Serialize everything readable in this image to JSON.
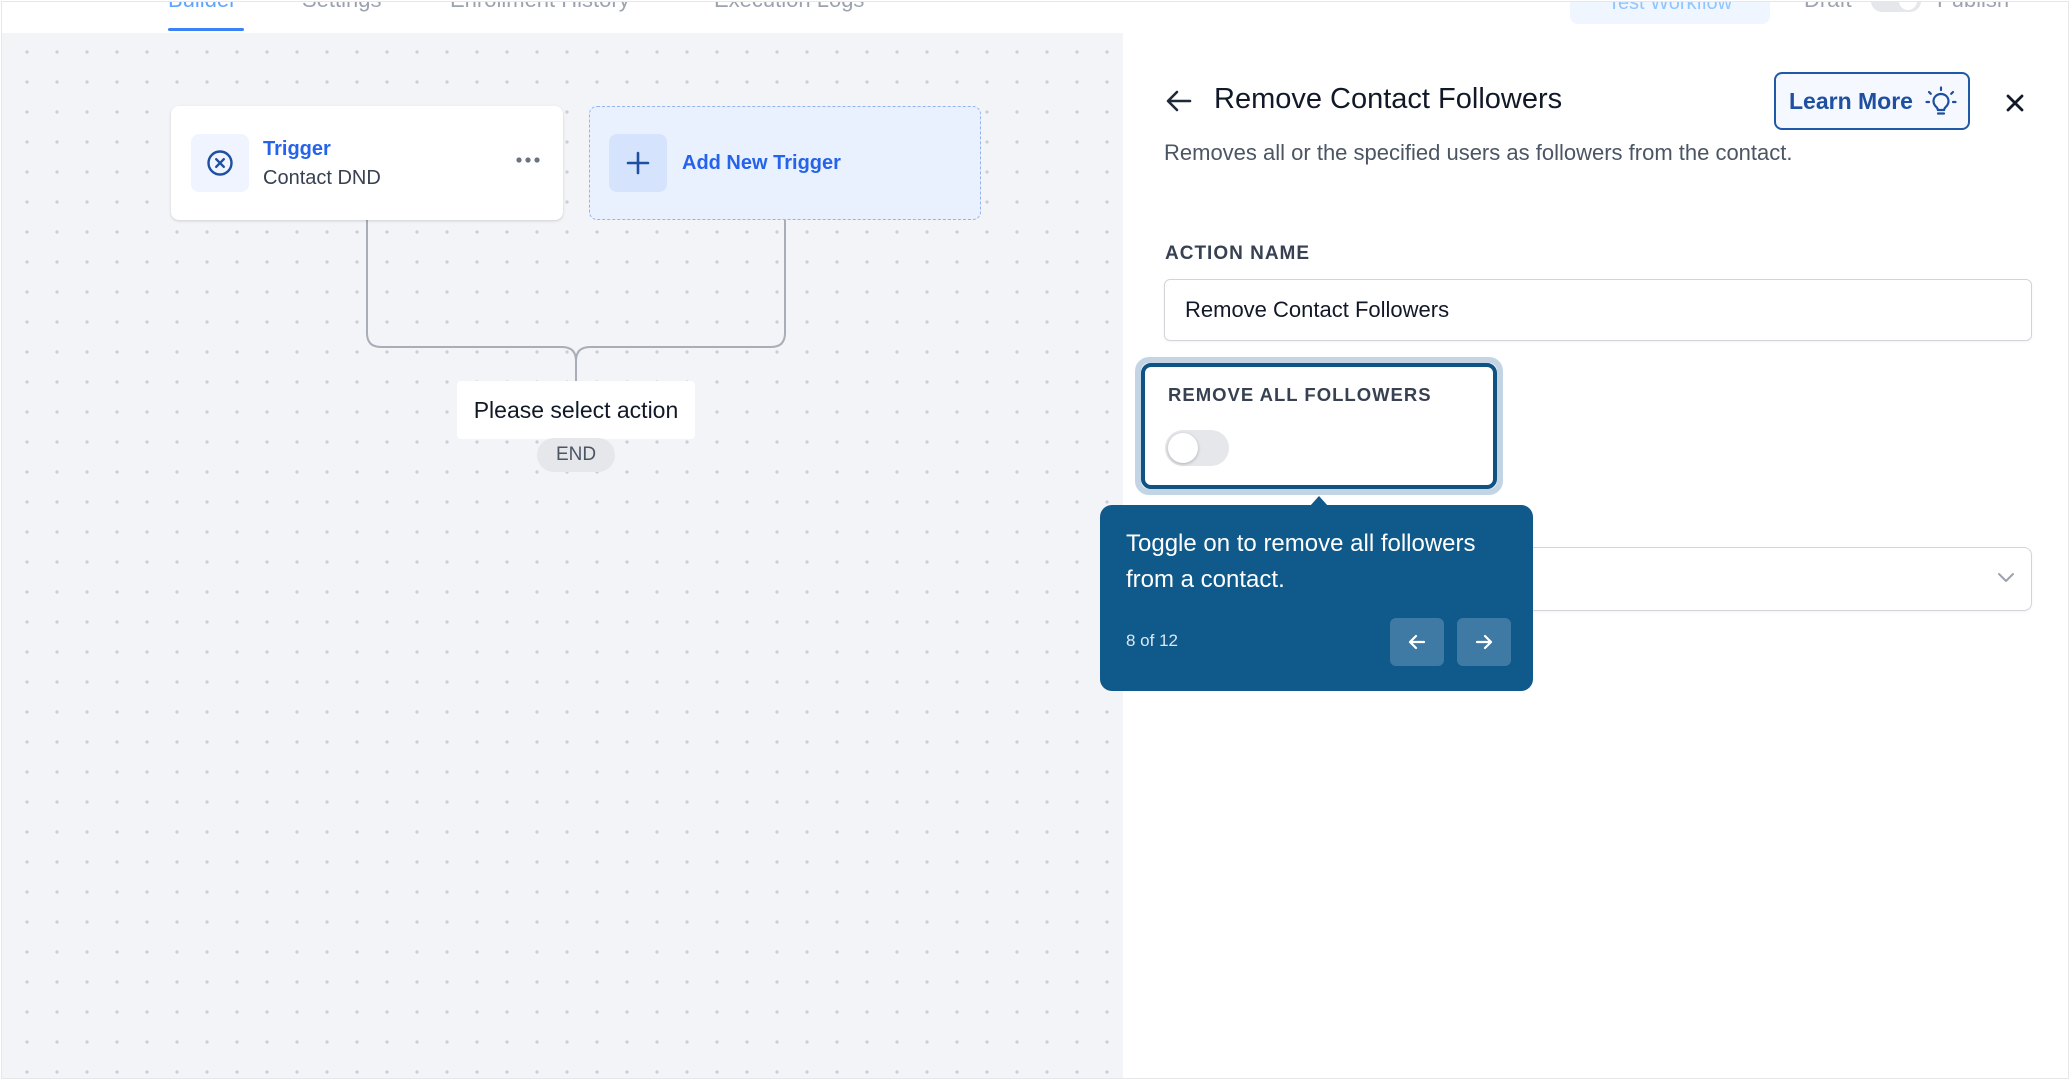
{
  "topnav": {
    "tabs": [
      "Builder",
      "Settings",
      "Enrollment History",
      "Execution Logs"
    ],
    "test_button": "Test Workflow",
    "draft_label": "Draft",
    "publish_label": "Publish"
  },
  "canvas": {
    "trigger_card": {
      "title": "Trigger",
      "subtitle": "Contact DND"
    },
    "add_trigger_label": "Add New Trigger",
    "action_placeholder": "Please select action",
    "end_label": "END"
  },
  "panel": {
    "title": "Remove Contact Followers",
    "learn_more": "Learn More",
    "description": "Removes all or the specified users as followers from the contact.",
    "action_name_label": "ACTION NAME",
    "action_name_value": "Remove Contact Followers",
    "remove_all_label": "REMOVE ALL FOLLOWERS",
    "remove_all_enabled": false
  },
  "tour": {
    "text": "Toggle on to remove all followers from a contact.",
    "progress": "8 of 12"
  },
  "colors": {
    "accent_blue": "#2563eb",
    "tour_bg": "#0f5a8a",
    "highlight_border": "#0f5384"
  },
  "icons": [
    "close-circle-icon",
    "more-horizontal-icon",
    "plus-icon",
    "arrow-left-icon",
    "lightbulb-icon",
    "close-icon",
    "chevron-down-icon",
    "arrow-right-icon"
  ]
}
